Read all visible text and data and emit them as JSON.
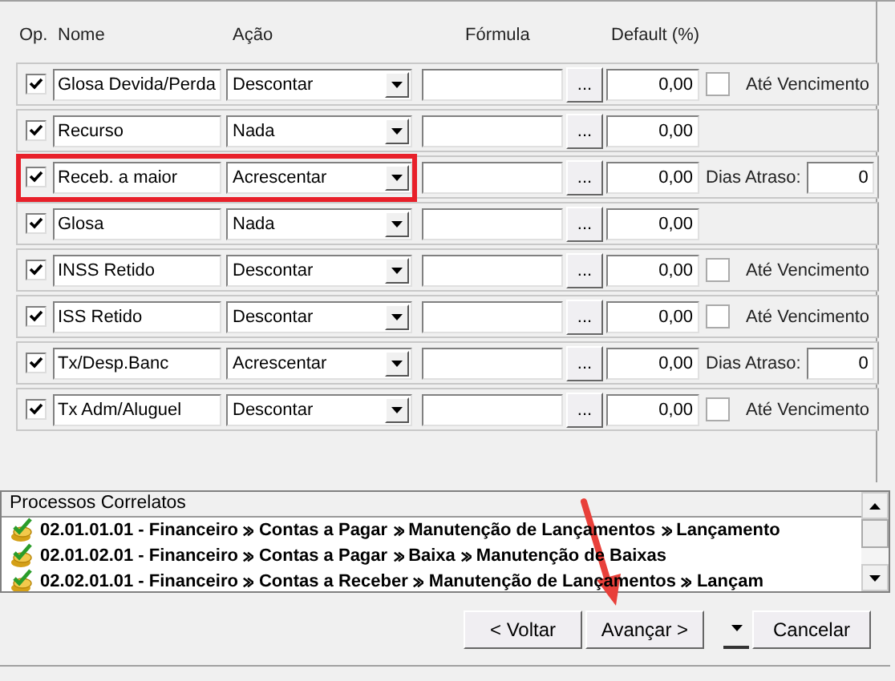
{
  "columns": [
    "Op.",
    "Nome",
    "Ação",
    "Fórmula",
    "Default (%)"
  ],
  "rows": [
    {
      "checked": true,
      "name": "Glosa Devida/Perda",
      "action": "Descontar",
      "formula": "",
      "formula_button": "...",
      "default": "0,00",
      "highlighted": false,
      "kind": "due",
      "extra_label": "Até Vencimento",
      "extra_checked": false
    },
    {
      "checked": true,
      "name": "Recurso",
      "action": "Nada",
      "formula": "",
      "formula_button": "...",
      "default": "0,00",
      "highlighted": false,
      "kind": "none"
    },
    {
      "checked": true,
      "name": "Receb. a maior",
      "action": "Acrescentar",
      "formula": "",
      "formula_button": "...",
      "default": "0,00",
      "highlighted": true,
      "kind": "delay",
      "extra_label": "Dias Atraso:",
      "extra_value": "0"
    },
    {
      "checked": true,
      "name": "Glosa",
      "action": "Nada",
      "formula": "",
      "formula_button": "...",
      "default": "0,00",
      "highlighted": false,
      "kind": "none"
    },
    {
      "checked": true,
      "name": "INSS Retido",
      "action": "Descontar",
      "formula": "",
      "formula_button": "...",
      "default": "0,00",
      "highlighted": false,
      "kind": "due",
      "extra_label": "Até Vencimento",
      "extra_checked": false
    },
    {
      "checked": true,
      "name": "ISS Retido",
      "action": "Descontar",
      "formula": "",
      "formula_button": "...",
      "default": "0,00",
      "highlighted": false,
      "kind": "due",
      "extra_label": "Até Vencimento",
      "extra_checked": false
    },
    {
      "checked": true,
      "name": "Tx/Desp.Banc",
      "action": "Acrescentar",
      "formula": "",
      "formula_button": "...",
      "default": "0,00",
      "highlighted": false,
      "kind": "delay",
      "extra_label": "Dias Atraso:",
      "extra_value": "0"
    },
    {
      "checked": true,
      "name": "Tx Adm/Aluguel",
      "action": "Descontar",
      "formula": "",
      "formula_button": "...",
      "default": "0,00",
      "highlighted": false,
      "kind": "due",
      "extra_label": "Até Vencimento",
      "extra_checked": false
    }
  ],
  "processes": {
    "title": "Processos Correlatos",
    "items": [
      {
        "code": "02.01.01.01 -",
        "path": [
          "Financeiro",
          "Contas a Pagar",
          "Manutenção de Lançamentos",
          "Lançamento"
        ]
      },
      {
        "code": "02.01.02.01 -",
        "path": [
          "Financeiro",
          "Contas a Pagar",
          "Baixa",
          "Manutenção de Baixas"
        ]
      },
      {
        "code": "02.02.01.01 -",
        "path": [
          "Financeiro",
          "Contas a Receber",
          "Manutenção de Lançamentos",
          "Lançam"
        ]
      }
    ]
  },
  "buttons": {
    "back": "< Voltar",
    "next": "Avançar >",
    "cancel": "Cancelar"
  },
  "annotations": [
    {
      "kind": "arrow"
    }
  ]
}
